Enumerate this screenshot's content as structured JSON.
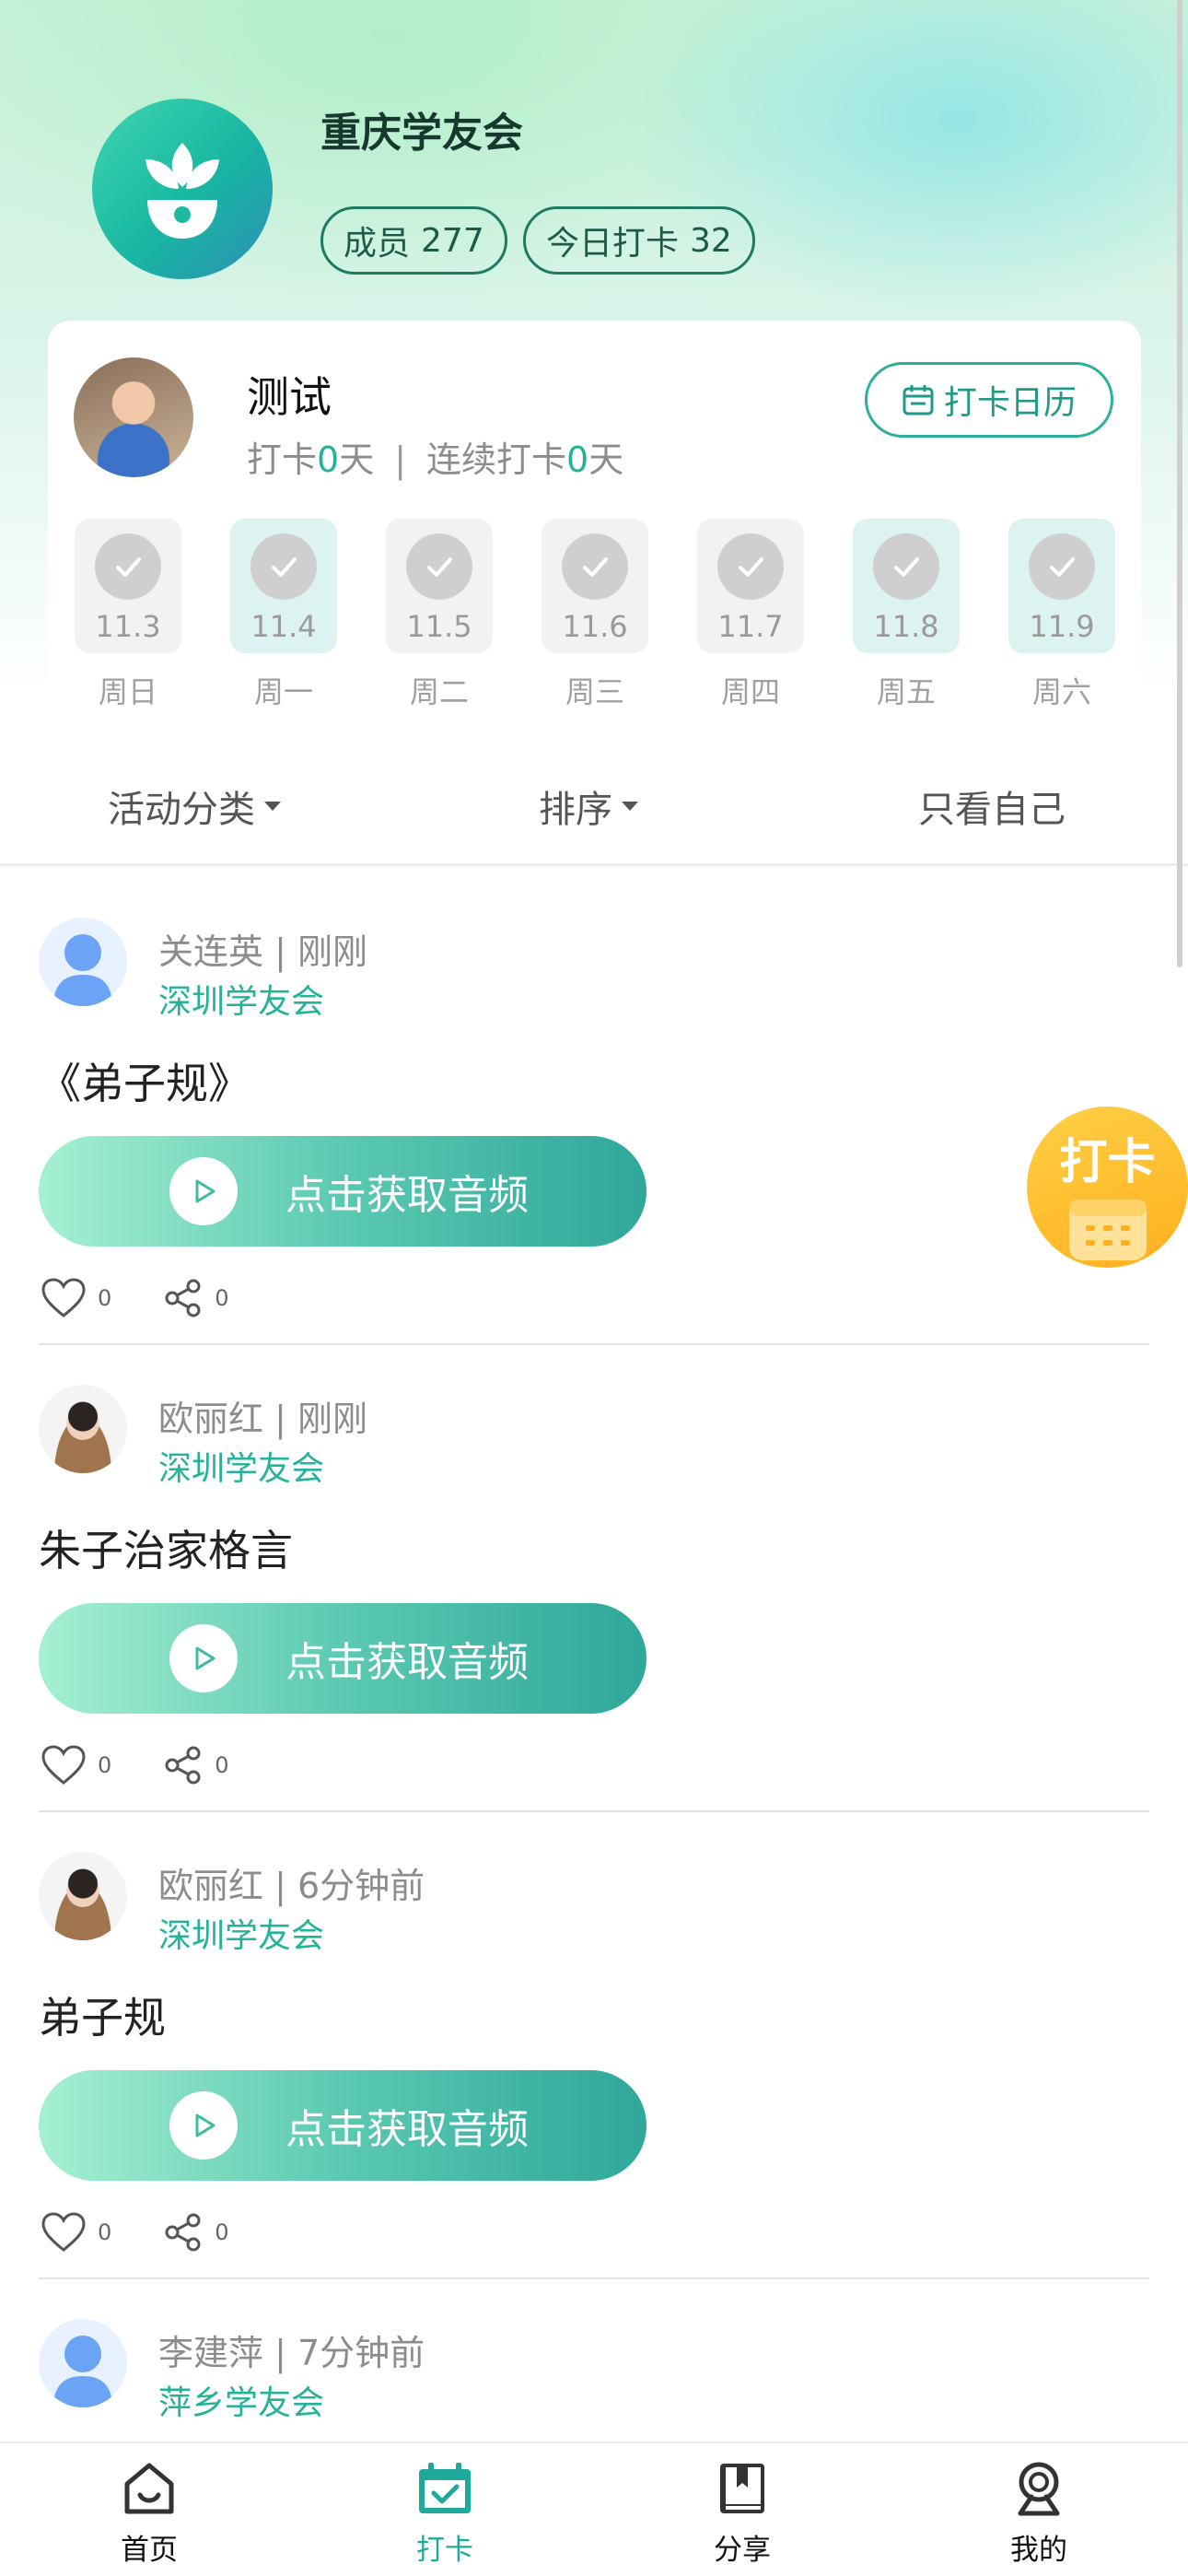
{
  "group": {
    "name": "重庆学友会",
    "members_label": "成员",
    "members_count": "277",
    "today_checkin_label": "今日打卡",
    "today_checkin_count": "32"
  },
  "user": {
    "name": "测试",
    "checkin_prefix": "打卡",
    "checkin_days": "0",
    "days_unit": "天",
    "separator": "|",
    "streak_prefix": "连续打卡",
    "streak_days": "0",
    "calendar_button": "打卡日历"
  },
  "week": [
    {
      "date": "11.3",
      "weekday": "周日",
      "active": false
    },
    {
      "date": "11.4",
      "weekday": "周一",
      "active": true
    },
    {
      "date": "11.5",
      "weekday": "周二",
      "active": false
    },
    {
      "date": "11.6",
      "weekday": "周三",
      "active": false
    },
    {
      "date": "11.7",
      "weekday": "周四",
      "active": false
    },
    {
      "date": "11.8",
      "weekday": "周五",
      "active": true
    },
    {
      "date": "11.9",
      "weekday": "周六",
      "active": true
    }
  ],
  "filters": {
    "category": "活动分类",
    "sort": "排序",
    "only_mine": "只看自己"
  },
  "posts": [
    {
      "author_line": "关连英 | 刚刚",
      "group": "深圳学友会",
      "title": "《弟子规》",
      "audio_label": "点击获取音频",
      "likes": "0",
      "shares": "0"
    },
    {
      "author_line": "欧丽红 | 刚刚",
      "group": "深圳学友会",
      "title": "朱子治家格言",
      "audio_label": "点击获取音频",
      "likes": "0",
      "shares": "0"
    },
    {
      "author_line": "欧丽红 | 6分钟前",
      "group": "深圳学友会",
      "title": "弟子规",
      "audio_label": "点击获取音频",
      "likes": "0",
      "shares": "0"
    },
    {
      "author_line": "李建萍 | 7分钟前",
      "group": "萍乡学友会"
    }
  ],
  "float_button": {
    "label": "打卡"
  },
  "tabbar": {
    "home": "首页",
    "checkin": "打卡",
    "share": "分享",
    "mine": "我的"
  },
  "colors": {
    "accent": "#24b39a",
    "float_button": "#ffb01f",
    "active_day": "#dcf3f1"
  }
}
